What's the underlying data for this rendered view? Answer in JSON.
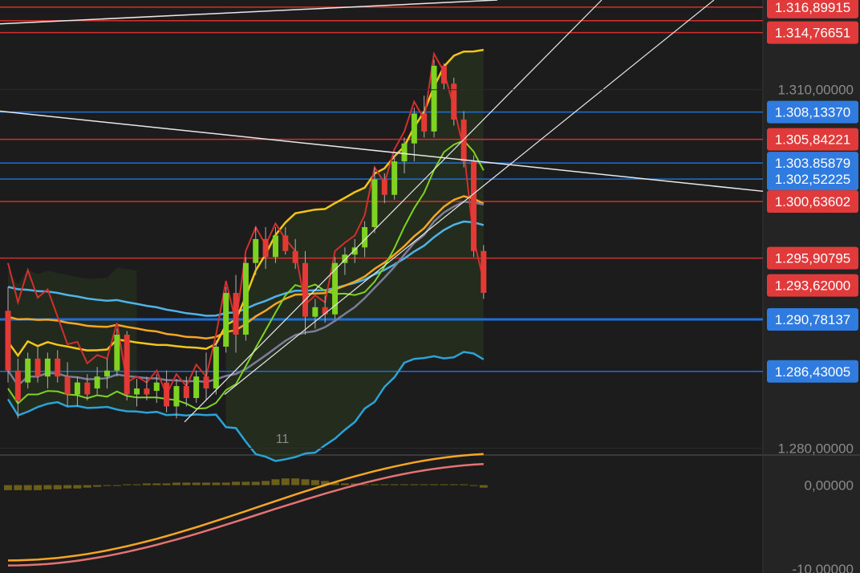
{
  "colors": {
    "background": "#1c1c1c",
    "axis_panel": "#242424",
    "up_candle": "#7ed321",
    "down_candle": "#e53935",
    "red_line": "#d32f2f",
    "blue_line": "#1e6fd9",
    "yellow_band": "#f5c518",
    "green_band": "#7ed321",
    "cyan_band": "#29a3d8",
    "gray_ma": "#7c7d9a",
    "orange_ma": "#f5a623",
    "light_blue_ma": "#4fb3e8",
    "white_line": "#e8e8e8",
    "cloud_fill": "#2a3a1f",
    "macd_hist": "#6b5e1a",
    "macd_line": "#f5a623",
    "signal_line": "#e57373"
  },
  "chart_data": [
    {
      "type": "candlestick",
      "ylim": [
        1.2795,
        1.3175
      ],
      "x_label": "11",
      "y_ticks": [
        {
          "value": 1.31,
          "label": "1.310,00000"
        },
        {
          "value": 1.28,
          "label": "1.280,00000"
        }
      ],
      "horizontal_levels": [
        {
          "value": 1.3169,
          "label": "1.316,89915",
          "color": "red"
        },
        {
          "value": 1.31577,
          "label": "",
          "color": "red"
        },
        {
          "value": 1.31477,
          "label": "1.314,76651",
          "color": "red"
        },
        {
          "value": 1.30813,
          "label": "1.308,13370",
          "color": "blue"
        },
        {
          "value": 1.30584,
          "label": "1.305,84221",
          "color": "red"
        },
        {
          "value": 1.30386,
          "label": "1.303,85879",
          "color": "blue"
        },
        {
          "value": 1.30252,
          "label": "1.302,52225",
          "color": "blue"
        },
        {
          "value": 1.30064,
          "label": "1.300,63602",
          "color": "red"
        },
        {
          "value": 1.29591,
          "label": "1.295,90795",
          "color": "red"
        },
        {
          "value": 1.29362,
          "label": "1.293,62000",
          "color": "red_label_only"
        },
        {
          "value": 1.29078,
          "label": "1.290,78137",
          "color": "blue_thick"
        },
        {
          "value": 1.28643,
          "label": "1.286,43005",
          "color": "blue"
        }
      ],
      "candles": [
        [
          1.2915,
          1.2935,
          1.2855,
          1.2865
        ],
        [
          1.2865,
          1.2875,
          1.2825,
          1.284
        ],
        [
          1.2855,
          1.288,
          1.285,
          1.2875
        ],
        [
          1.2875,
          1.2885,
          1.2855,
          1.286
        ],
        [
          1.286,
          1.288,
          1.285,
          1.2875
        ],
        [
          1.2875,
          1.2882,
          1.2855,
          1.286
        ],
        [
          1.286,
          1.2872,
          1.2835,
          1.2845
        ],
        [
          1.2845,
          1.286,
          1.2835,
          1.2855
        ],
        [
          1.2855,
          1.2862,
          1.284,
          1.2845
        ],
        [
          1.285,
          1.2868,
          1.2845,
          1.286
        ],
        [
          1.286,
          1.2875,
          1.285,
          1.2865
        ],
        [
          1.2865,
          1.29,
          1.286,
          1.2895
        ],
        [
          1.2895,
          1.2898,
          1.284,
          1.2845
        ],
        [
          1.2845,
          1.2858,
          1.2835,
          1.285
        ],
        [
          1.285,
          1.286,
          1.284,
          1.2845
        ],
        [
          1.2848,
          1.2862,
          1.2838,
          1.2855
        ],
        [
          1.2855,
          1.2865,
          1.283,
          1.2835
        ],
        [
          1.2835,
          1.2858,
          1.2825,
          1.2852
        ],
        [
          1.2852,
          1.286,
          1.2835,
          1.2842
        ],
        [
          1.2842,
          1.2865,
          1.2838,
          1.286
        ],
        [
          1.286,
          1.288,
          1.284,
          1.285
        ],
        [
          1.285,
          1.289,
          1.2845,
          1.2885
        ],
        [
          1.2885,
          1.2935,
          1.288,
          1.293
        ],
        [
          1.293,
          1.2945,
          1.288,
          1.2895
        ],
        [
          1.2895,
          1.296,
          1.289,
          1.2955
        ],
        [
          1.2955,
          1.2985,
          1.2945,
          1.2975
        ],
        [
          1.2975,
          1.2985,
          1.295,
          1.296
        ],
        [
          1.296,
          1.2985,
          1.2955,
          1.2978
        ],
        [
          1.2978,
          1.2985,
          1.2962,
          1.2965
        ],
        [
          1.2965,
          1.2975,
          1.295,
          1.2955
        ],
        [
          1.2955,
          1.2965,
          1.2895,
          1.291
        ],
        [
          1.291,
          1.2925,
          1.29,
          1.2918
        ],
        [
          1.2918,
          1.2928,
          1.2905,
          1.2912
        ],
        [
          1.2912,
          1.296,
          1.2908,
          1.2955
        ],
        [
          1.2955,
          1.2968,
          1.2945,
          1.2962
        ],
        [
          1.2962,
          1.2975,
          1.2955,
          1.2968
        ],
        [
          1.2968,
          1.299,
          1.296,
          1.2985
        ],
        [
          1.2985,
          1.3035,
          1.298,
          1.3025
        ],
        [
          1.3025,
          1.303,
          1.3005,
          1.3012
        ],
        [
          1.3012,
          1.3045,
          1.3008,
          1.304
        ],
        [
          1.304,
          1.306,
          1.303,
          1.3055
        ],
        [
          1.3055,
          1.3085,
          1.304,
          1.308
        ],
        [
          1.308,
          1.3095,
          1.306,
          1.3065
        ],
        [
          1.3065,
          1.3125,
          1.306,
          1.312
        ],
        [
          1.312,
          1.3122,
          1.31,
          1.3105
        ],
        [
          1.3105,
          1.311,
          1.307,
          1.3075
        ],
        [
          1.3075,
          1.3082,
          1.3035,
          1.304
        ],
        [
          1.304,
          1.3045,
          1.296,
          1.2965
        ],
        [
          1.2965,
          1.297,
          1.2925,
          1.293
        ]
      ]
    },
    {
      "type": "macd",
      "ylim": [
        -0.0105,
        0.0035
      ],
      "y_ticks": [
        {
          "value": 0.0,
          "label": "0,00000"
        },
        {
          "value": -0.01,
          "label": "-10,00000"
        }
      ],
      "histogram": [
        -0.0006,
        -0.0006,
        -0.0006,
        -0.0006,
        -0.0005,
        -0.0005,
        -0.0004,
        -0.0004,
        -0.0003,
        -0.0002,
        -0.0001,
        -0.0001,
        0.0001,
        0.0001,
        0.0002,
        0.0002,
        0.0002,
        0.0003,
        0.0003,
        0.0003,
        0.0003,
        0.0003,
        0.0003,
        0.0004,
        0.0004,
        0.0004,
        0.0005,
        0.0007,
        0.0008,
        0.0008,
        0.0007,
        0.0006,
        0.0005,
        0.0003,
        0.0002,
        0.0002,
        0.0001,
        0.0001,
        0.0001,
        0.0001,
        0.0001,
        0.0001,
        0.0001,
        0.0001,
        0.0001,
        0.0001,
        0.0001,
        0.0,
        -0.0003
      ]
    }
  ]
}
